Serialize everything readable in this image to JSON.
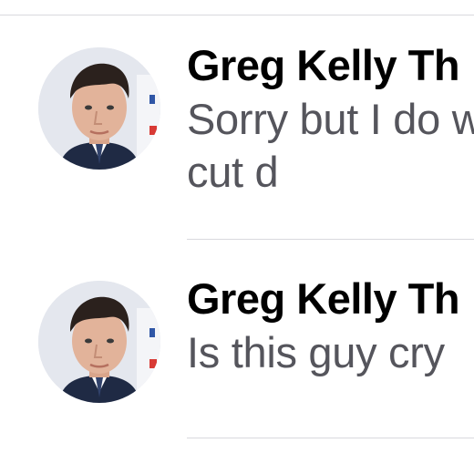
{
  "conversations": [
    {
      "sender": "Greg Kelly Th",
      "preview": "Sorry but I do was ever cut d",
      "avatar_icon": "profile-photo-greg-kelly"
    },
    {
      "sender": "Greg Kelly Th",
      "preview": "Is this guy cry",
      "avatar_icon": "profile-photo-greg-kelly"
    }
  ],
  "colors": {
    "background": "#ffffff",
    "sender_text": "#000000",
    "preview_text": "#55555c",
    "divider": "#d9d9de"
  }
}
